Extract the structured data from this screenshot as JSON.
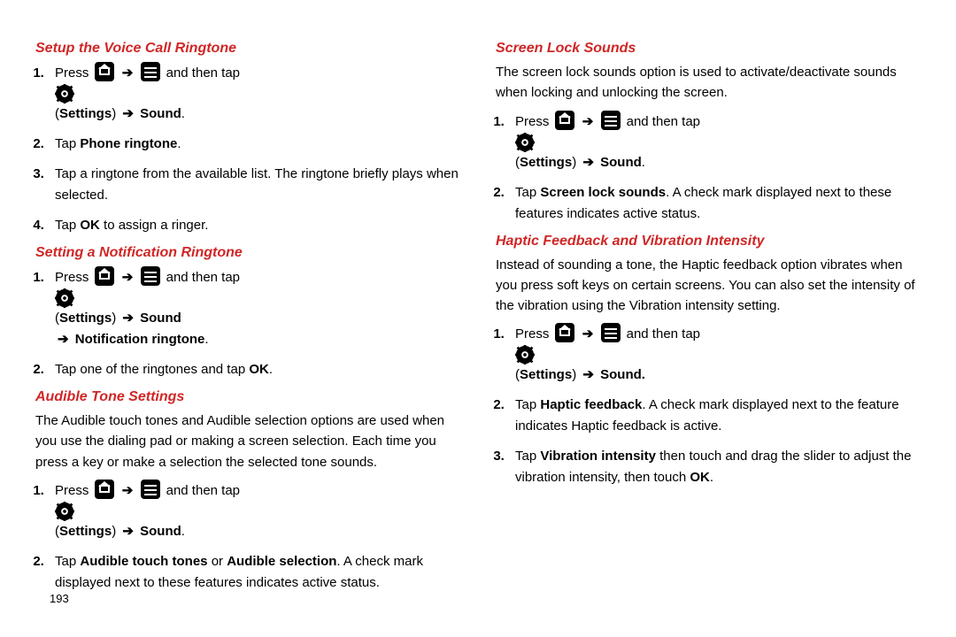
{
  "page_number": "193",
  "arrow": "➔",
  "common": {
    "press": "Press",
    "and_then_tap": "and then tap",
    "settings": "Settings",
    "sound": "Sound",
    "sound_period": "Sound."
  },
  "left": {
    "h1": "Setup the Voice Call Ringtone",
    "s1_step2": "Phone ringtone",
    "s1_step2_pre": "Tap ",
    "s1_step2_post": ".",
    "s1_step3": "Tap a ringtone from the available list. The ringtone briefly plays when selected.",
    "s1_step4_pre": "Tap ",
    "s1_step4_bold": "OK",
    "s1_step4_post": " to assign a ringer.",
    "h2": "Setting a Notification Ringtone",
    "s2_line2_bold": "Notification ringtone",
    "s2_step2_pre": "Tap one of the ringtones and tap ",
    "s2_step2_bold": "OK",
    "s2_step2_post": ".",
    "h3": "Audible Tone Settings",
    "s3_intro": "The Audible touch tones and Audible selection options are used when you use the dialing pad or making a screen selection. Each time you press a key or make a selection the selected tone sounds.",
    "s3_step2_pre": "Tap ",
    "s3_step2_b1": "Audible touch tones",
    "s3_step2_mid": " or ",
    "s3_step2_b2": "Audible selection",
    "s3_step2_post": ". A check mark displayed next to these features indicates active status."
  },
  "right": {
    "h1": "Screen Lock Sounds",
    "r1_intro": "The screen lock sounds option is used to activate/deactivate sounds when locking and unlocking the screen.",
    "r1_step2_pre": "Tap ",
    "r1_step2_bold": "Screen lock sounds",
    "r1_step2_post": ". A check mark displayed next to these features indicates active status.",
    "h2": "Haptic Feedback and Vibration Intensity",
    "r2_intro": "Instead of sounding a tone, the Haptic feedback option vibrates when you press soft keys on certain screens. You can also set the intensity of the vibration using the Vibration intensity setting.",
    "r2_step2_pre": "Tap ",
    "r2_step2_bold": "Haptic feedback",
    "r2_step2_post": ". A check mark displayed next to the feature indicates Haptic feedback is active.",
    "r2_step3_pre": "Tap ",
    "r2_step3_bold": "Vibration intensity",
    "r2_step3_mid": " then touch and drag the slider to adjust the vibration intensity, then touch ",
    "r2_step3_bold2": "OK",
    "r2_step3_post": "."
  }
}
